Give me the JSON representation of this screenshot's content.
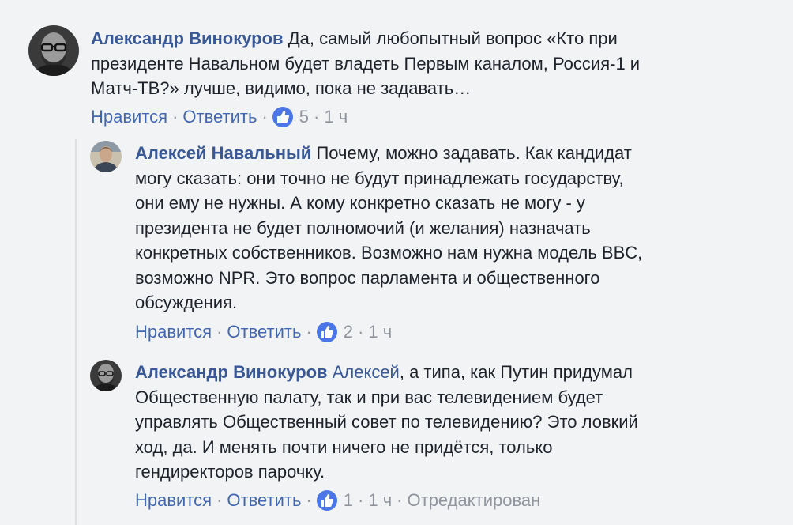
{
  "comments": [
    {
      "author": "Александр Винокуров",
      "lines": [
        "Да, самый любопытный вопрос «Кто при",
        "президенте Навальном будет владеть Первым каналом, Россия-1 и",
        "Матч-ТВ?» лучше, видимо, пока не задавать…"
      ],
      "like_label": "Нравится",
      "reply_label": "Ответить",
      "likes": "5",
      "time": "1 ч"
    },
    {
      "author": "Алексей Навальный",
      "lines": [
        "Почему, можно задавать. Как кандидат",
        "могу сказать: они точно не будут принадлежать государству,",
        "они ему не нужны. А кому конкретно сказать не могу - у",
        "президента не будет полномочий (и желания) назначать",
        "конкретных собственников. Возможно нам нужна модель BBC,",
        "возможно NPR. Это вопрос парламента и общественного",
        "обсуждения."
      ],
      "like_label": "Нравится",
      "reply_label": "Ответить",
      "likes": "2",
      "time": "1 ч"
    },
    {
      "author": "Александр Винокуров",
      "mention": "Алексей",
      "lines": [
        ", а типа, как Путин придумал",
        "Общественную палату, так и при вас телевидением будет",
        "управлять Общественный совет по телевидению? Это ловкий",
        "ход, да. И менять почти ничего не придётся, только",
        "гендиректоров парочку."
      ],
      "like_label": "Нравится",
      "reply_label": "Ответить",
      "likes": "1",
      "time": "1 ч",
      "edited": "Отредактирован"
    }
  ],
  "colors": {
    "background": "#f2f3f5",
    "author": "#385898",
    "link": "#4267b2",
    "meta": "#90949c",
    "like_badge": "#4a76e8"
  },
  "icons": {
    "like": "thumbs-up-icon"
  }
}
